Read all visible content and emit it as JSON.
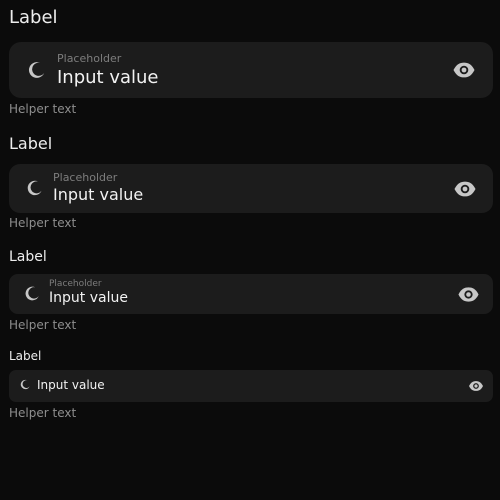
{
  "fields": [
    {
      "label": "Label",
      "placeholder": "Placeholder",
      "value": "Input value",
      "helper": "Helper text",
      "leading_icon": "moon-icon",
      "trailing_icon": "eye-icon"
    },
    {
      "label": "Label",
      "placeholder": "Placeholder",
      "value": "Input value",
      "helper": "Helper text",
      "leading_icon": "moon-icon",
      "trailing_icon": "eye-icon"
    },
    {
      "label": "Label",
      "placeholder": "Placeholder",
      "value": "Input value",
      "helper": "Helper text",
      "leading_icon": "moon-icon",
      "trailing_icon": "eye-icon"
    },
    {
      "label": "Label",
      "value": "Input value",
      "helper": "Helper text",
      "leading_icon": "moon-icon",
      "trailing_icon": "eye-icon"
    }
  ],
  "colors": {
    "background": "#0b0b0b",
    "field": "#1c1c1c",
    "text": "#f2f2f2",
    "placeholder": "#7d7d7d",
    "helper": "#8e8e8e",
    "icon": "#c7c7c7"
  }
}
